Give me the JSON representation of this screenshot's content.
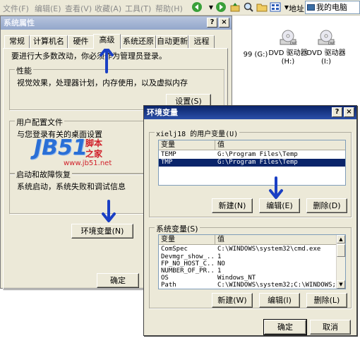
{
  "explorer": {
    "menu": [
      "文件(F)",
      "编辑(E)",
      "查看(V)",
      "收藏(A)",
      "工具(T)",
      "帮助(H)"
    ],
    "address_label": "地址",
    "address_value": "我的电脑",
    "drives": [
      {
        "label": "99 (G:)",
        "icon": "dvd-drive-icon"
      },
      {
        "label": "DVD 驱动器\n(H:)",
        "icon": "dvd-drive-icon"
      },
      {
        "label": "DVD 驱动器\n(I:)",
        "icon": "dvd-drive-icon"
      }
    ]
  },
  "system_properties": {
    "title": "系统属性",
    "help_glyph": "?",
    "close_glyph": "×",
    "tabs": [
      "常规",
      "计算机名",
      "硬件",
      "高级",
      "系统还原",
      "自动更新",
      "远程"
    ],
    "selected_tab": "高级",
    "admin_note": "要进行大多数改动，你必须作为管理员登录。",
    "performance": {
      "label": "性能",
      "desc": "视觉效果，处理器计划，内存使用，以及虚拟内存",
      "button": "设置(S)"
    },
    "user_profiles": {
      "label": "用户配置文件",
      "desc": "与您登录有关的桌面设置"
    },
    "startup_recovery": {
      "label": "启动和故障恢复",
      "desc": "系统启动，系统失败和调试信息"
    },
    "env_button": "环境变量(N)",
    "ok_button": "确定"
  },
  "env_dialog": {
    "title": "环境变量",
    "help_glyph": "?",
    "close_glyph": "×",
    "user_group_label": "xielj18 的用户变量(U)",
    "user_columns": [
      "变量",
      "值"
    ],
    "user_vars": [
      {
        "name": "TEMP",
        "value": "G:\\Program Files\\Temp",
        "selected": false
      },
      {
        "name": "TMP",
        "value": "G:\\Program Files\\Temp",
        "selected": true
      }
    ],
    "user_buttons": {
      "new": "新建(N)",
      "edit": "编辑(E)",
      "delete": "删除(D)"
    },
    "sys_group_label": "系统变量(S)",
    "sys_columns": [
      "变量",
      "值"
    ],
    "sys_vars": [
      {
        "name": "ComSpec",
        "value": "C:\\WINDOWS\\system32\\cmd.exe"
      },
      {
        "name": "Devmgr_show_...",
        "value": "1"
      },
      {
        "name": "FP_NO_HOST_C...",
        "value": "NO"
      },
      {
        "name": "NUMBER_OF_PR...",
        "value": "1"
      },
      {
        "name": "OS",
        "value": "Windows_NT"
      },
      {
        "name": "Path",
        "value": "C:\\WINDOWS\\system32;C:\\WINDOWS;..."
      }
    ],
    "sys_buttons": {
      "new": "新建(W)",
      "edit": "编辑(I)",
      "delete": "删除(L)"
    },
    "ok_button": "确定",
    "cancel_button": "取消"
  },
  "watermark": {
    "logo": "JB51",
    "cn": "脚本",
    "cn2": "之家",
    "url": "www.jb51.net"
  },
  "colors": {
    "title_active": "#0a246a",
    "selection": "#0a246a",
    "dialog_face": "#ece9d8",
    "annotation_arrow": "#1a3fc4",
    "watermark_red": "#d0202a",
    "watermark_blue": "#2a6fd6"
  }
}
